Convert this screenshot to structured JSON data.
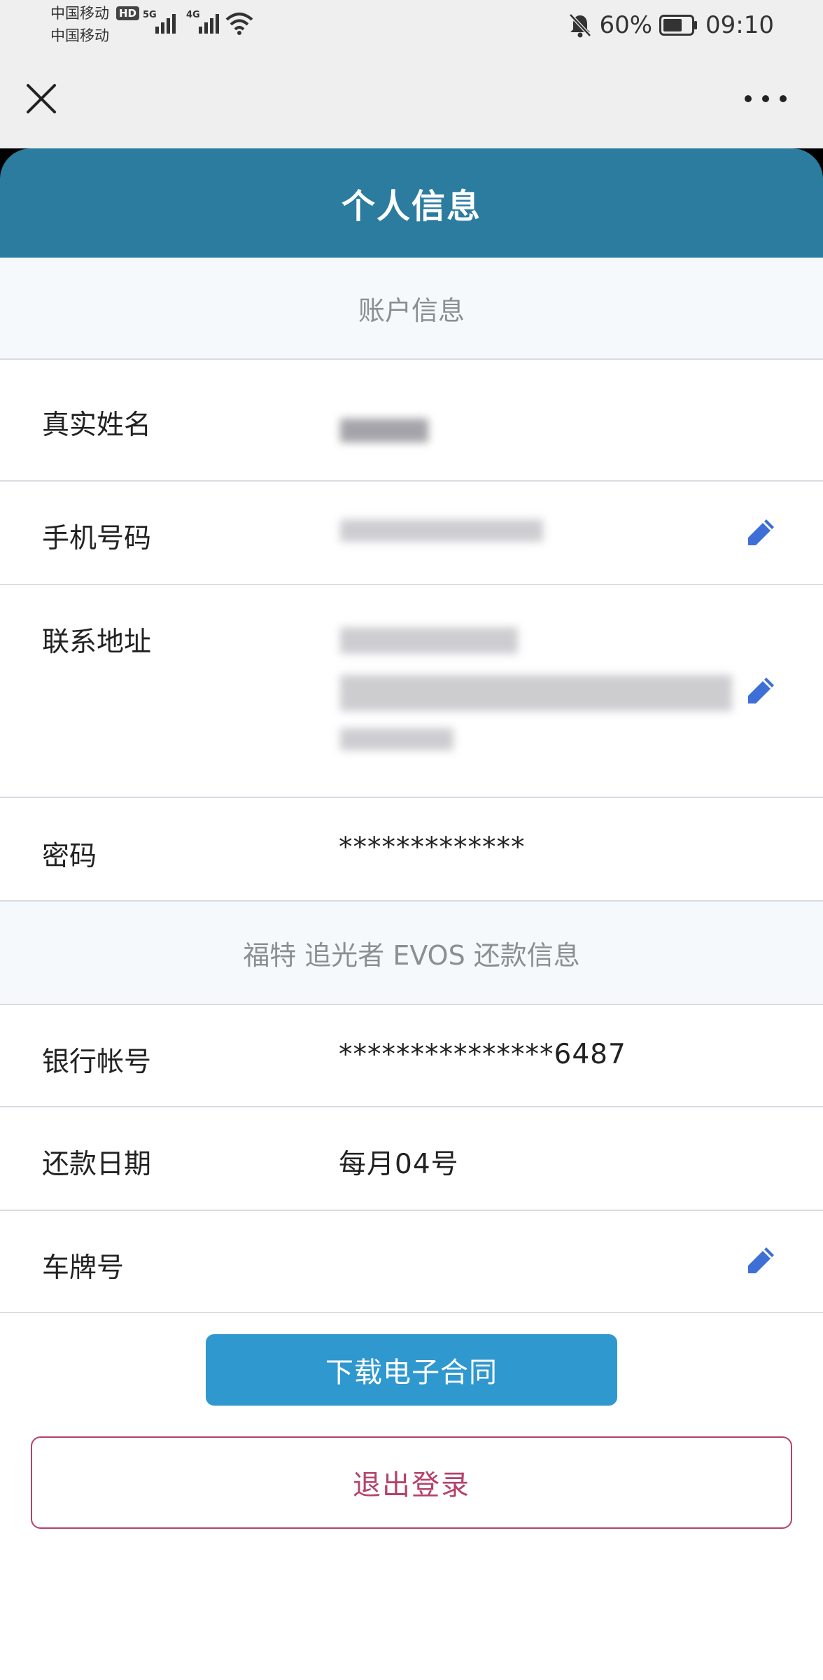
{
  "status_bar": {
    "carrier1": "中国移动",
    "carrier2": "中国移动",
    "hd_badge": "HD",
    "sim1_net": "5G",
    "sim2_net": "4G",
    "battery": "60%",
    "time": "09:10"
  },
  "header": {
    "title": "个人信息"
  },
  "account_section": {
    "title": "账户信息",
    "rows": [
      {
        "label": "真实姓名",
        "value": ""
      },
      {
        "label": "手机号码",
        "value": ""
      },
      {
        "label": "联系地址",
        "value": ""
      },
      {
        "label": "密码",
        "value": "*************"
      }
    ]
  },
  "repay_section": {
    "title": "福特 追光者 EVOS 还款信息",
    "rows": [
      {
        "label": "银行帐号",
        "value": "***************6487"
      },
      {
        "label": "还款日期",
        "value": "每月04号"
      },
      {
        "label": "车牌号",
        "value": ""
      }
    ]
  },
  "buttons": {
    "download_contract": "下载电子合同",
    "logout": "退出登录"
  },
  "colors": {
    "header": "#2b7c9f",
    "primary_button": "#2f98cf",
    "logout": "#b5426a",
    "edit_icon": "#3d6fd6"
  },
  "icons": [
    "close-icon",
    "more-icon",
    "edit-pencil-icon",
    "bell-off-icon",
    "battery-icon",
    "wifi-icon",
    "signal-icon"
  ]
}
